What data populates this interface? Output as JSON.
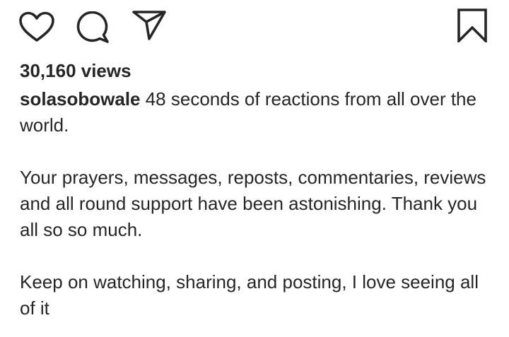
{
  "actions": {
    "like_icon": "heart-outline",
    "comment_icon": "speech-bubble-outline",
    "share_icon": "paper-plane-outline",
    "save_icon": "bookmark-outline"
  },
  "post": {
    "views_text": "30,160 views",
    "username": "solasobowale",
    "caption_first": " 48 seconds of reactions from all over the world.",
    "caption_second": "Your prayers, messages, reposts, commentaries, reviews and all round support have been astonishing. Thank you all so so much.",
    "caption_third": "Keep on watching, sharing, and posting, I love seeing all of it"
  },
  "colors": {
    "text": "#262626",
    "background": "#ffffff"
  }
}
